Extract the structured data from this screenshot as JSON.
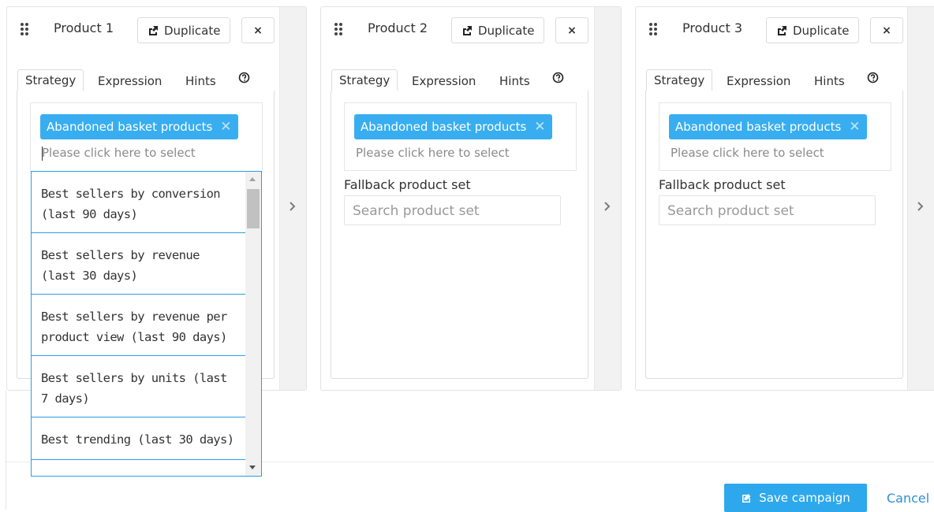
{
  "products": [
    {
      "title": "Product 1",
      "duplicate_label": "Duplicate",
      "close_label": "×",
      "tabs": [
        "Strategy",
        "Expression",
        "Hints"
      ],
      "selected_tag": "Abandoned basket products",
      "placeholder": "Please click here to select",
      "dropdown_open": true
    },
    {
      "title": "Product 2",
      "duplicate_label": "Duplicate",
      "close_label": "×",
      "tabs": [
        "Strategy",
        "Expression",
        "Hints"
      ],
      "selected_tag": "Abandoned basket products",
      "placeholder": "Please click here to select",
      "fallback_label": "Fallback product set",
      "fallback_placeholder": "Search product set"
    },
    {
      "title": "Product 3",
      "duplicate_label": "Duplicate",
      "close_label": "×",
      "tabs": [
        "Strategy",
        "Expression",
        "Hints"
      ],
      "selected_tag": "Abandoned basket products",
      "placeholder": "Please click here to select",
      "fallback_label": "Fallback product set",
      "fallback_placeholder": "Search product set"
    }
  ],
  "dropdown_options": [
    "Best sellers by conversion (last 90 days)",
    "Best sellers by revenue (last 30 days)",
    "Best sellers by revenue per product view (last 90 days)",
    "Best sellers by units (last 7 days)",
    "Best trending (last 30 days)"
  ],
  "footer": {
    "save_label": "Save campaign",
    "cancel_label": "Cancel"
  },
  "colors": {
    "accent": "#38aef0",
    "link": "#2e8fd6"
  },
  "icons": {
    "drag": "drag-handle-icon",
    "duplicate": "share-icon",
    "help": "help-circle-icon",
    "next": "chevron-right-icon",
    "save": "edit-icon"
  }
}
